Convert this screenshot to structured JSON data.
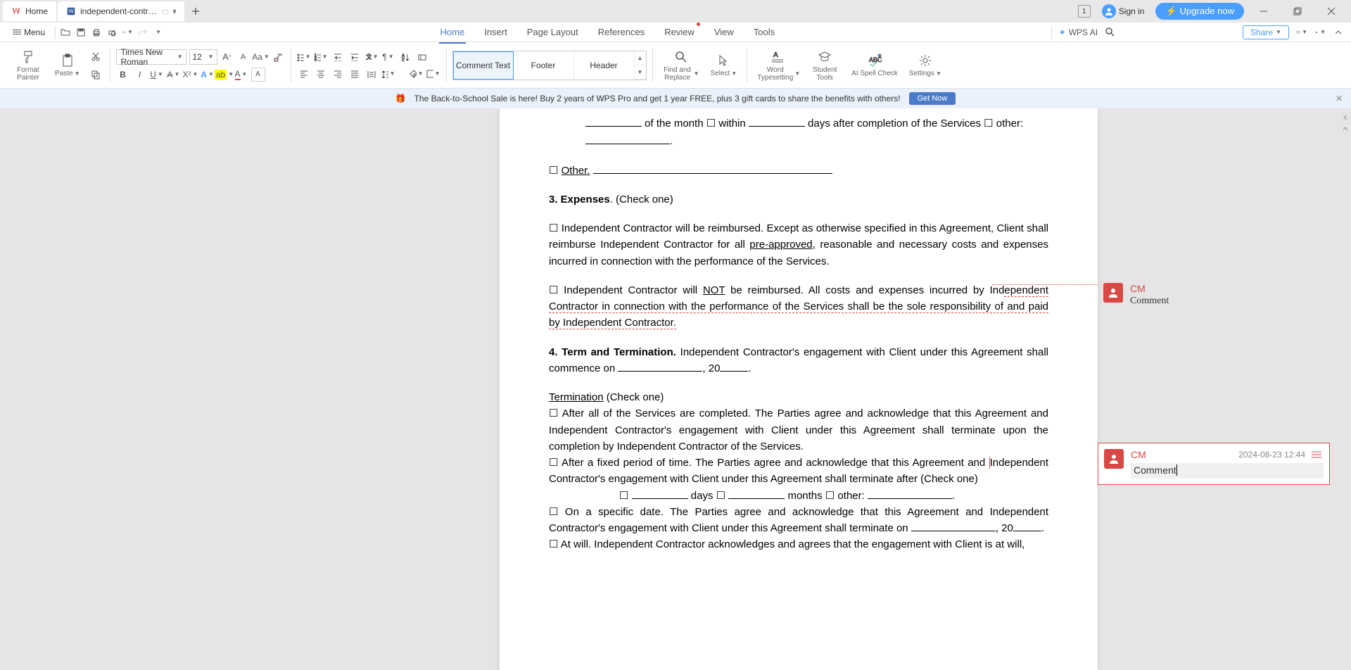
{
  "titlebar": {
    "home_label": "Home",
    "doc_label": "independent-contractor-agree",
    "badge": "1",
    "signin": "Sign in",
    "upgrade": "Upgrade now"
  },
  "menubar": {
    "menu": "Menu",
    "tabs": [
      "Home",
      "Insert",
      "Page Layout",
      "References",
      "Review",
      "View",
      "Tools"
    ],
    "ai": "WPS AI",
    "share": "Share"
  },
  "ribbon": {
    "format_painter": "Format Painter",
    "paste": "Paste",
    "font_name": "Times New Roman",
    "font_size": "12",
    "styles": [
      "Comment Text",
      "Footer",
      "Header"
    ],
    "find_replace": "Find and Replace",
    "select": "Select",
    "word_typesetting": "Word Typesetting",
    "student_tools": "Student Tools",
    "spell_check": "AI Spell Check",
    "settings": "Settings"
  },
  "promo": {
    "text": "The Back-to-School Sale is here! Buy 2 years of WPS Pro and get 1 year FREE, plus 3 gift cards to share the benefits with others!",
    "btn": "Get Now"
  },
  "doc": {
    "l1a": " of the month ",
    "l1b": " within ",
    "l1c": " days after completion of the Services ",
    "l1d": " other: ",
    "other": "Other.",
    "s3_title": "3. Expenses",
    "s3_check": ". (Check one)",
    "s3_p1": " Independent Contractor will be reimbursed. Except as otherwise specified in this Agreement, Client shall reimburse Independent Contractor for all ",
    "pre_approved": "pre-approved,",
    "s3_p1b": " reasonable and necessary costs and expenses incurred in connection with the performance of the Services.",
    "s3_p2a": " Independent Contractor will ",
    "not": "NOT",
    "s3_p2b": " be reimbursed. All costs and expenses incurred by Ind",
    "s3_p2c": "ependent Contractor in connection with the performance of the Services shall be the sole responsibility of and paid by Independent Contractor.",
    "s4_title": "4. Term and Termination.",
    "s4_p1": " Independent Contractor's engagement with Client under this Agreement shall commence on ",
    "s4_date": ", 20",
    "term": "Termination",
    "term_check": " (Check one)",
    "t1": " After all of the Services are completed. The Parties agree and acknowledge that this Agreement and Independent Contractor's engagement with Client under this Agreement shall terminate upon the completion by Independent Contractor of the Services.",
    "t2a": " After a fixed period of time. The Parties agree and acknowledge that this Agreement and ",
    "t2b": "Independent Contractor's engagement with Client under this Agreement shall terminate after (Check one)",
    "t2_days": " days ",
    "t2_months": " months ",
    "t2_other": " other: ",
    "t3a": " On a specific date. The Parties agree and acknowledge that this Agreement and Independent Contractor's engagement with Client under this Agreement shall terminate on ",
    "t3b": ", 20",
    "t4": " At will. Independent Contractor acknowledges and agrees that the engagement with Client is at will,"
  },
  "comments": {
    "c1": {
      "author": "CM",
      "text": "Comment"
    },
    "c2": {
      "author": "CM",
      "time": "2024-08-23 12:44",
      "text": "Comment"
    }
  }
}
